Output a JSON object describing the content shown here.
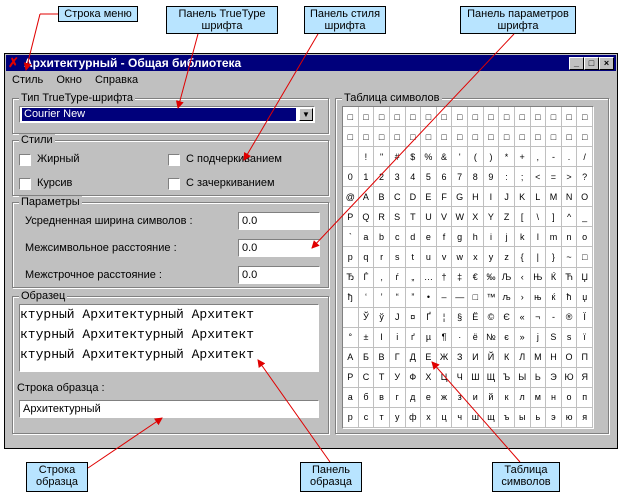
{
  "callouts": {
    "menu_bar": "Строка меню",
    "truetype_panel": "Панель TrueType шрифта",
    "style_panel": "Панель стиля шрифта",
    "params_panel": "Панель параметров шрифта",
    "sample_line": "Строка образца",
    "sample_panel": "Панель образца",
    "char_table": "Таблица символов"
  },
  "window": {
    "title": "Архитектурный - Общая библиотека",
    "minimize": "_",
    "maximize": "□",
    "close": "×"
  },
  "menu": [
    "Стиль",
    "Окно",
    "Справка"
  ],
  "truetype": {
    "legend": "Тип TrueType-шрифта",
    "selected_font": "Courier New",
    "dropdown_glyph": "▼"
  },
  "styles": {
    "legend": "Стили",
    "bold": "Жирный",
    "italic": "Курсив",
    "underline": "С подчеркиванием",
    "strikeout": "С зачеркиванием"
  },
  "params": {
    "legend": "Параметры",
    "avg_width_label": "Усредненная ширина символов :",
    "avg_width_value": "0.0",
    "char_spacing_label": "Межсимвольное расстояние :",
    "char_spacing_value": "0.0",
    "line_spacing_label": "Межстрочное расстояние :",
    "line_spacing_value": "0.0"
  },
  "sample": {
    "legend": "Образец",
    "lines": [
      "ктурный Архитектурный Архитект",
      "ктурный Архитектурный Архитект",
      "ктурный Архитектурный Архитект"
    ],
    "string_label": "Строка образца :",
    "string_value": "Архитектурный"
  },
  "char_table": {
    "legend": "Таблица символов",
    "rows": [
      [
        "□",
        "□",
        "□",
        "□",
        "□",
        "□",
        "□",
        "□",
        "□",
        "□",
        "□",
        "□",
        "□",
        "□",
        "□",
        "□"
      ],
      [
        "□",
        "□",
        "□",
        "□",
        "□",
        "□",
        "□",
        "□",
        "□",
        "□",
        "□",
        "□",
        "□",
        "□",
        "□",
        "□"
      ],
      [
        "",
        "!",
        "\"",
        "#",
        "$",
        "%",
        "&",
        "'",
        "(",
        ")",
        "*",
        "+",
        ",",
        "-",
        ".",
        "/"
      ],
      [
        "0",
        "1",
        "2",
        "3",
        "4",
        "5",
        "6",
        "7",
        "8",
        "9",
        ":",
        ";",
        "<",
        "=",
        ">",
        "?"
      ],
      [
        "@",
        "A",
        "B",
        "C",
        "D",
        "E",
        "F",
        "G",
        "H",
        "I",
        "J",
        "K",
        "L",
        "M",
        "N",
        "O"
      ],
      [
        "P",
        "Q",
        "R",
        "S",
        "T",
        "U",
        "V",
        "W",
        "X",
        "Y",
        "Z",
        "[",
        "\\",
        "]",
        "^",
        "_"
      ],
      [
        "`",
        "a",
        "b",
        "c",
        "d",
        "e",
        "f",
        "g",
        "h",
        "i",
        "j",
        "k",
        "l",
        "m",
        "n",
        "o"
      ],
      [
        "p",
        "q",
        "r",
        "s",
        "t",
        "u",
        "v",
        "w",
        "x",
        "y",
        "z",
        "{",
        "|",
        "}",
        "~",
        "□"
      ],
      [
        "Ђ",
        "Ѓ",
        "‚",
        "ѓ",
        "„",
        "…",
        "†",
        "‡",
        "€",
        "‰",
        "Љ",
        "‹",
        "Њ",
        "Ќ",
        "Ћ",
        "Џ"
      ],
      [
        "ђ",
        "‘",
        "’",
        "“",
        "”",
        "•",
        "–",
        "—",
        "□",
        "™",
        "љ",
        "›",
        "њ",
        "ќ",
        "ћ",
        "џ"
      ],
      [
        "",
        "Ў",
        "ў",
        "Ј",
        "¤",
        "Ґ",
        "¦",
        "§",
        "Ё",
        "©",
        "Є",
        "«",
        "¬",
        "-",
        "®",
        "Ї"
      ],
      [
        "°",
        "±",
        "І",
        "і",
        "ґ",
        "µ",
        "¶",
        "·",
        "ё",
        "№",
        "є",
        "»",
        "ј",
        "Ѕ",
        "ѕ",
        "ї"
      ],
      [
        "А",
        "Б",
        "В",
        "Г",
        "Д",
        "Е",
        "Ж",
        "З",
        "И",
        "Й",
        "К",
        "Л",
        "М",
        "Н",
        "О",
        "П"
      ],
      [
        "Р",
        "С",
        "Т",
        "У",
        "Ф",
        "Х",
        "Ц",
        "Ч",
        "Ш",
        "Щ",
        "Ъ",
        "Ы",
        "Ь",
        "Э",
        "Ю",
        "Я"
      ],
      [
        "а",
        "б",
        "в",
        "г",
        "д",
        "е",
        "ж",
        "з",
        "и",
        "й",
        "к",
        "л",
        "м",
        "н",
        "о",
        "п"
      ],
      [
        "р",
        "с",
        "т",
        "у",
        "ф",
        "х",
        "ц",
        "ч",
        "ш",
        "щ",
        "ъ",
        "ы",
        "ь",
        "э",
        "ю",
        "я"
      ]
    ]
  }
}
